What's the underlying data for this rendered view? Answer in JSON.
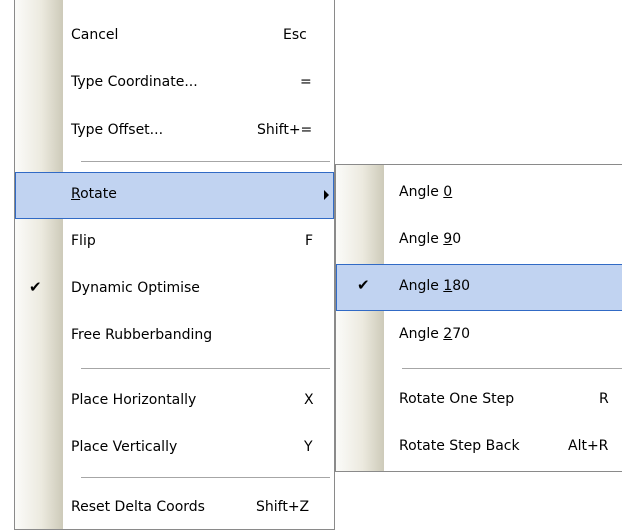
{
  "main_menu": {
    "items": [
      {
        "label": "Cancel",
        "shortcut": "Esc"
      },
      {
        "label": "Type Coordinate...",
        "shortcut": "="
      },
      {
        "label": "Type Offset...",
        "shortcut": "Shift+="
      },
      {
        "label_mnemonic": "R",
        "label_rest": "otate",
        "shortcut": ""
      },
      {
        "label": "Flip",
        "shortcut": "F"
      },
      {
        "label": "Dynamic Optimise",
        "shortcut": "",
        "checked": true
      },
      {
        "label": "Free Rubberbanding",
        "shortcut": ""
      },
      {
        "label": "Place Horizontally",
        "shortcut": "X"
      },
      {
        "label": "Place Vertically",
        "shortcut": "Y"
      },
      {
        "label": "Reset Delta Coords",
        "shortcut": "Shift+Z"
      }
    ],
    "highlighted": "Rotate"
  },
  "rotate_submenu": {
    "items": [
      {
        "label_prefix": "Angle ",
        "label_mnemonic": "0",
        "label_rest": ""
      },
      {
        "label_prefix": "Angle ",
        "label_mnemonic": "9",
        "label_rest": "0"
      },
      {
        "label_prefix": "Angle ",
        "label_mnemonic": "1",
        "label_rest": "80",
        "checked": true
      },
      {
        "label_prefix": "Angle ",
        "label_mnemonic": "2",
        "label_rest": "70"
      },
      {
        "label": "Rotate One Step",
        "shortcut": "R"
      },
      {
        "label": "Rotate Step Back",
        "shortcut": "Alt+R"
      }
    ],
    "highlighted": "Angle 180"
  },
  "icons": {
    "check": "checkmark-icon",
    "submenu_arrow": "submenu-arrow-icon"
  },
  "colors": {
    "highlight_fill": "#c1d3f1",
    "highlight_border": "#316ac5"
  }
}
